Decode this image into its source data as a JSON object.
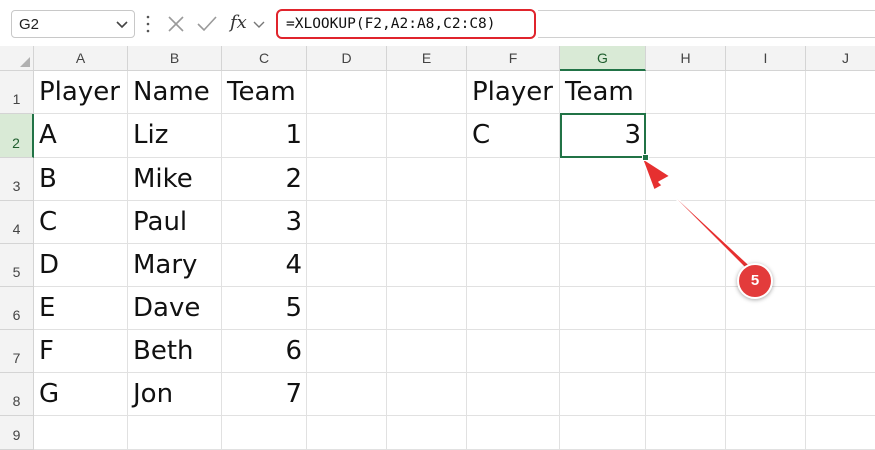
{
  "name_box": {
    "value": "G2"
  },
  "formula_bar": {
    "fx_label": "fx",
    "formula": "=XLOOKUP(F2,A2:A8,C2:C8)"
  },
  "columns": [
    "A",
    "B",
    "C",
    "D",
    "E",
    "F",
    "G",
    "H",
    "I",
    "J"
  ],
  "rows": [
    "1",
    "2",
    "3",
    "4",
    "5",
    "6",
    "7",
    "8",
    "9"
  ],
  "cells": {
    "A1": "Player",
    "B1": "Name",
    "C1": "Team",
    "A2": "A",
    "B2": "Liz",
    "C2": "1",
    "A3": "B",
    "B3": "Mike",
    "C3": "2",
    "A4": "C",
    "B4": "Paul",
    "C4": "3",
    "A5": "D",
    "B5": "Mary",
    "C5": "4",
    "A6": "E",
    "B6": "Dave",
    "C6": "5",
    "A7": "F",
    "B7": "Beth",
    "C7": "6",
    "A8": "G",
    "B8": "Jon",
    "C8": "7",
    "F1": "Player",
    "G1": "Team",
    "F2": "C",
    "G2": "3"
  },
  "selected_cell": "G2",
  "annotation": {
    "badge_label": "5"
  },
  "colors": {
    "accent": "#217346",
    "highlight": "#e0242c",
    "badge": "#e33b3b"
  },
  "icons": [
    "chevron-down-icon",
    "cancel-icon",
    "enter-icon",
    "fx-icon",
    "select-all-icon"
  ]
}
